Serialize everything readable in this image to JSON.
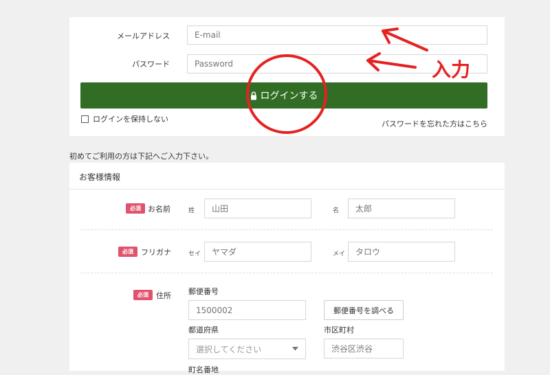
{
  "login": {
    "email_label": "メールアドレス",
    "email_placeholder": "E-mail",
    "password_label": "パスワード",
    "password_placeholder": "Password",
    "login_button": "ログインする",
    "remember_label": "ログインを保持しない",
    "forgot_link": "パスワードを忘れた方はこちら"
  },
  "annotation": {
    "text": "入力",
    "color": "#e52222"
  },
  "intro": "初めてご利用の方は下記へご入力下さい。",
  "customer": {
    "section_title": "お客様情報",
    "required_badge": "必須",
    "name": {
      "label": "お名前",
      "last_label": "姓",
      "last_placeholder": "山田",
      "first_label": "名",
      "first_placeholder": "太郎"
    },
    "kana": {
      "label": "フリガナ",
      "last_label": "セイ",
      "last_placeholder": "ヤマダ",
      "first_label": "メイ",
      "first_placeholder": "タロウ"
    },
    "address": {
      "label": "住所",
      "zip_label": "郵便番号",
      "zip_placeholder": "1500002",
      "zip_button": "郵便番号を調べる",
      "pref_label": "都道府県",
      "pref_placeholder": "選択してください",
      "city_label": "市区町村",
      "city_placeholder": "渋谷区渋谷",
      "town_label": "町名番地"
    }
  },
  "colors": {
    "login_button": "#316d24",
    "required_badge": "#e0526e"
  }
}
